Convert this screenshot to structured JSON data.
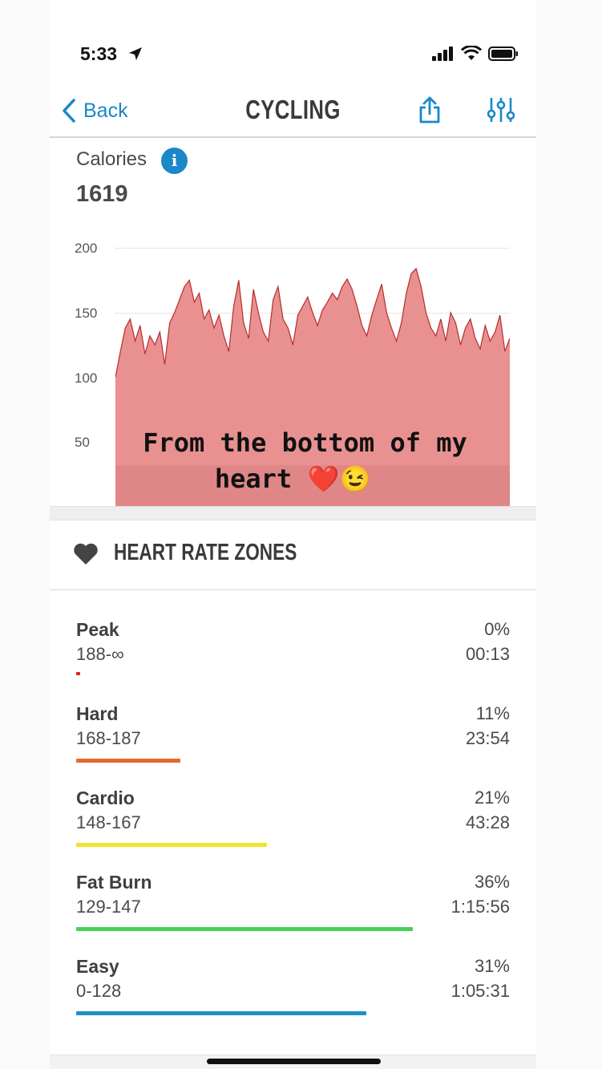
{
  "status_bar": {
    "time": "5:33"
  },
  "nav": {
    "back_label": "Back",
    "title": "CYCLING"
  },
  "calories": {
    "label": "Calories",
    "value": "1619"
  },
  "chart": {
    "y_ticks": [
      "200",
      "150",
      "100",
      "50"
    ],
    "fill_color": "#e99191",
    "line_color": "#b82c2c"
  },
  "chart_data": {
    "type": "area",
    "ylim": [
      0,
      200
    ],
    "y_ticks": [
      50,
      100,
      150,
      200
    ],
    "grid": true,
    "x": [
      0,
      1,
      2,
      3,
      4,
      5,
      6,
      7,
      8,
      9,
      10,
      11,
      12,
      13,
      14,
      15,
      16,
      17,
      18,
      19,
      20,
      21,
      22,
      23,
      24,
      25,
      26,
      27,
      28,
      29,
      30,
      31,
      32,
      33,
      34,
      35,
      36,
      37,
      38,
      39,
      40,
      41,
      42,
      43,
      44,
      45,
      46,
      47,
      48,
      49,
      50,
      51,
      52,
      53,
      54,
      55,
      56,
      57,
      58,
      59,
      60,
      61,
      62,
      63,
      64,
      65,
      66,
      67,
      68,
      69,
      70,
      71,
      72,
      73,
      74,
      75,
      76,
      77,
      78,
      79,
      80
    ],
    "values": [
      100,
      120,
      138,
      145,
      128,
      140,
      118,
      132,
      125,
      135,
      110,
      142,
      150,
      160,
      170,
      175,
      158,
      165,
      145,
      152,
      138,
      148,
      132,
      120,
      155,
      175,
      142,
      130,
      168,
      150,
      135,
      128,
      160,
      170,
      145,
      138,
      125,
      148,
      155,
      162,
      150,
      140,
      152,
      158,
      165,
      160,
      170,
      176,
      168,
      155,
      140,
      132,
      148,
      160,
      172,
      150,
      138,
      128,
      142,
      165,
      180,
      184,
      170,
      150,
      138,
      132,
      145,
      128,
      150,
      142,
      125,
      138,
      145,
      130,
      122,
      140,
      128,
      135,
      148,
      120,
      130
    ]
  },
  "overlay": {
    "line1": "From the bottom of my",
    "line2": "heart ❤️😉"
  },
  "zones": {
    "title": "HEART RATE ZONES",
    "items": [
      {
        "name": "Peak",
        "range": "188-∞",
        "percent": "0%",
        "time": "00:13",
        "color": "#e02020",
        "fraction": 0.01
      },
      {
        "name": "Hard",
        "range": "168-187",
        "percent": "11%",
        "time": "23:54",
        "color": "#e8682a",
        "fraction": 0.24
      },
      {
        "name": "Cardio",
        "range": "148-167",
        "percent": "21%",
        "time": "43:28",
        "color": "#f2e22b",
        "fraction": 0.44
      },
      {
        "name": "Fat Burn",
        "range": "129-147",
        "percent": "36%",
        "time": "1:15:56",
        "color": "#47d157",
        "fraction": 0.776
      },
      {
        "name": "Easy",
        "range": "0-128",
        "percent": "31%",
        "time": "1:05:31",
        "color": "#1d8fc7",
        "fraction": 0.67
      }
    ]
  }
}
